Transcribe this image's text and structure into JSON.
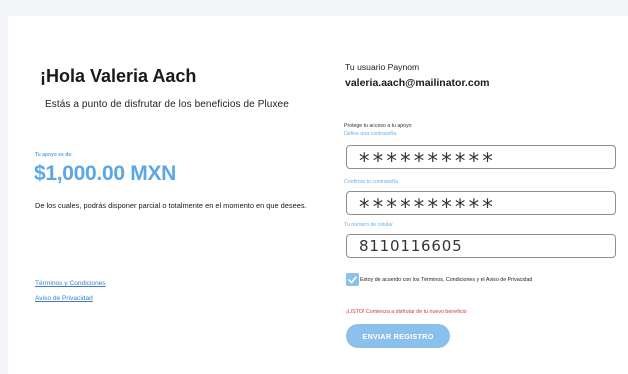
{
  "left": {
    "greeting": "¡Hola Valeria Aach",
    "subtitle": "Estás a punto de disfrutar de los beneficios de Pluxee",
    "support_label": "Tu apoyo es de:",
    "amount": "$1,000.00 MXN",
    "description": "De los cuales, podrás disponer parcial o totalmente en el momento en que desees.",
    "terms_link": "Términos y Condiciones",
    "privacy_link": "Aviso de Privacidad"
  },
  "right": {
    "user_label": "Tu usuario Paynom",
    "user_email": "valeria.aach@mailinator.com",
    "protect_label": "Protege tu acceso a tu apoyo",
    "password_label": "Define una contraseña",
    "password_value": "**********",
    "confirm_label": "Confirma tu contraseña",
    "confirm_value": "**********",
    "phone_label": "Tu número de celular",
    "phone_value": "8110116605",
    "checkbox_checked": true,
    "terms_text": "Estoy de acuerdo con los Términos, Condiciones y el Aviso de Privacidad",
    "ready_text": "¡LISTO! Comienza a disfrutar de tu nuevo beneficio",
    "submit_label": "ENVIAR REGISTRO"
  },
  "colors": {
    "accent": "#5ba7e3",
    "button": "#8cc0ec",
    "link": "#3d7fc6",
    "success_text": "#d9352b"
  },
  "icons": {
    "checkbox": "check-icon"
  }
}
